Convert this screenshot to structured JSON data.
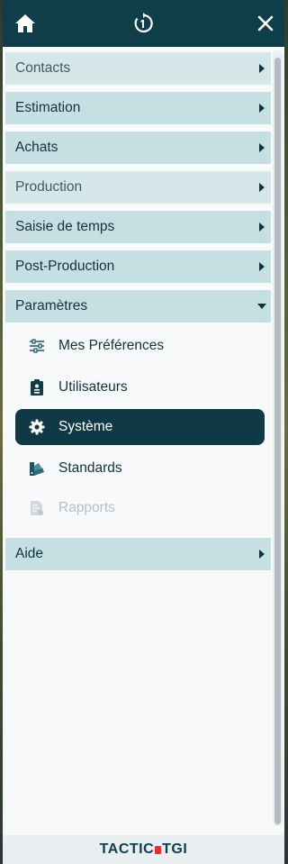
{
  "topbar": {
    "home_icon": "home-icon",
    "history_icon": "history-icon",
    "close_icon": "close-icon"
  },
  "menu": {
    "items": [
      {
        "label": "Contacts",
        "state": "collapsed"
      },
      {
        "label": "Estimation",
        "state": "collapsed"
      },
      {
        "label": "Achats",
        "state": "collapsed"
      },
      {
        "label": "Production",
        "state": "collapsed"
      },
      {
        "label": "Saisie de temps",
        "state": "collapsed"
      },
      {
        "label": "Post-Production",
        "state": "collapsed"
      },
      {
        "label": "Paramètres",
        "state": "expanded"
      },
      {
        "label": "Aide",
        "state": "collapsed"
      }
    ],
    "parametres_subitems": [
      {
        "label": "Mes Préférences",
        "icon": "sliders-icon",
        "state": "normal"
      },
      {
        "label": "Utilisateurs",
        "icon": "user-badge-icon",
        "state": "normal"
      },
      {
        "label": "Système",
        "icon": "gear-icon",
        "state": "active"
      },
      {
        "label": "Standards",
        "icon": "swatch-icon",
        "state": "normal"
      },
      {
        "label": "Rapports",
        "icon": "report-icon",
        "state": "disabled"
      }
    ]
  },
  "footer": {
    "logo_left": "TACTIC",
    "logo_right": "TGI"
  },
  "colors": {
    "topbar": "#0f3d4a",
    "menu_item_bg": "#c6dfe3",
    "active_bg": "#0f3a45",
    "logo_red": "#d9332b"
  }
}
